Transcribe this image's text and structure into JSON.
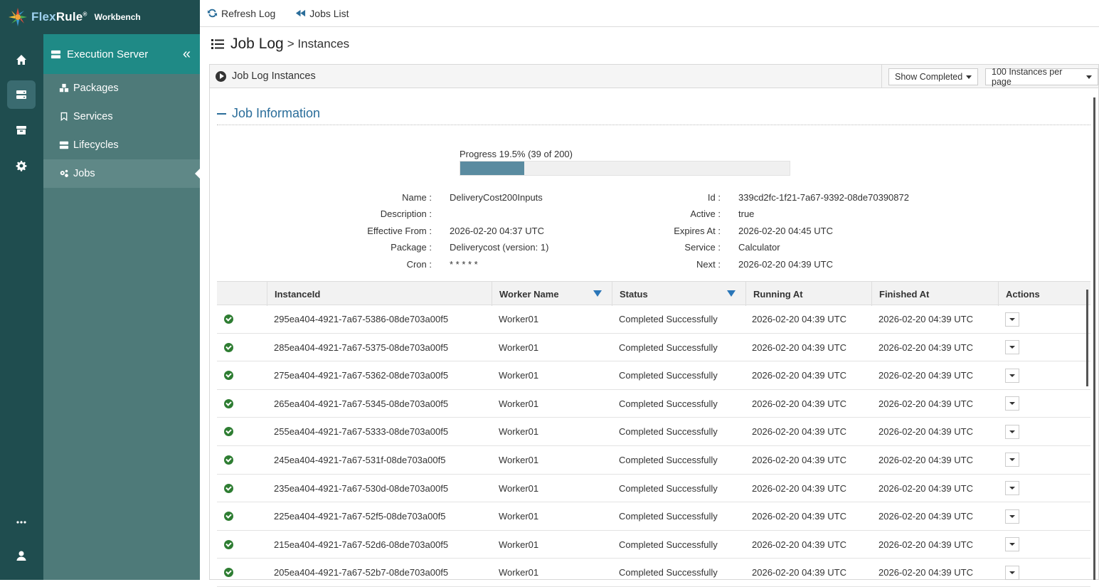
{
  "brand": {
    "name_a": "Flex",
    "name_b": "Rule",
    "reg": "®",
    "product": "Workbench"
  },
  "rail": {
    "icons": [
      "home-icon",
      "server-icon",
      "archive-icon",
      "gear-icon",
      "more-icon",
      "user-icon"
    ]
  },
  "sidebar": {
    "title": "Execution Server",
    "collapse": "«",
    "items": [
      {
        "label": "Packages",
        "icon": "cubes-icon"
      },
      {
        "label": "Services",
        "icon": "bookmark-icon"
      },
      {
        "label": "Lifecycles",
        "icon": "server-icon"
      },
      {
        "label": "Jobs",
        "icon": "gears-icon"
      }
    ]
  },
  "toolbar": {
    "refresh": "Refresh Log",
    "jobs_list": "Jobs List"
  },
  "page": {
    "title": "Job Log",
    "crumb": "> Instances"
  },
  "panel": {
    "title": "Job Log Instances",
    "filter": "Show Completed",
    "per_page": "100 Instances per page"
  },
  "section": {
    "title": "Job Information"
  },
  "progress": {
    "label": "Progress 19.5% (39 of 200)",
    "fraction": 0.195
  },
  "info": {
    "name_label": "Name :",
    "name": "DeliveryCost200Inputs",
    "desc_label": "Description :",
    "desc": "",
    "eff_label": "Effective From :",
    "eff": "2026-02-20 04:37 UTC",
    "pkg_label": "Package :",
    "pkg": "Deliverycost (version: 1)",
    "cron_label": "Cron :",
    "cron": "* * * * *",
    "id_label": "Id :",
    "id": "339cd2fc-1f21-7a67-9392-08de70390872",
    "active_label": "Active :",
    "active": "true",
    "exp_label": "Expires At :",
    "exp": "2026-02-20 04:45 UTC",
    "svc_label": "Service :",
    "svc": "Calculator",
    "next_label": "Next :",
    "next": "2026-02-20 04:39 UTC"
  },
  "table": {
    "headers": [
      "InstanceId",
      "Worker Name",
      "Status",
      "Running At",
      "Finished At",
      "Actions"
    ],
    "rows": [
      [
        "295ea404-4921-7a67-5386-08de703a00f5",
        "Worker01",
        "Completed Successfully",
        "2026-02-20 04:39 UTC",
        "2026-02-20 04:39 UTC"
      ],
      [
        "285ea404-4921-7a67-5375-08de703a00f5",
        "Worker01",
        "Completed Successfully",
        "2026-02-20 04:39 UTC",
        "2026-02-20 04:39 UTC"
      ],
      [
        "275ea404-4921-7a67-5362-08de703a00f5",
        "Worker01",
        "Completed Successfully",
        "2026-02-20 04:39 UTC",
        "2026-02-20 04:39 UTC"
      ],
      [
        "265ea404-4921-7a67-5345-08de703a00f5",
        "Worker01",
        "Completed Successfully",
        "2026-02-20 04:39 UTC",
        "2026-02-20 04:39 UTC"
      ],
      [
        "255ea404-4921-7a67-5333-08de703a00f5",
        "Worker01",
        "Completed Successfully",
        "2026-02-20 04:39 UTC",
        "2026-02-20 04:39 UTC"
      ],
      [
        "245ea404-4921-7a67-531f-08de703a00f5",
        "Worker01",
        "Completed Successfully",
        "2026-02-20 04:39 UTC",
        "2026-02-20 04:39 UTC"
      ],
      [
        "235ea404-4921-7a67-530d-08de703a00f5",
        "Worker01",
        "Completed Successfully",
        "2026-02-20 04:39 UTC",
        "2026-02-20 04:39 UTC"
      ],
      [
        "225ea404-4921-7a67-52f5-08de703a00f5",
        "Worker01",
        "Completed Successfully",
        "2026-02-20 04:39 UTC",
        "2026-02-20 04:39 UTC"
      ],
      [
        "215ea404-4921-7a67-52d6-08de703a00f5",
        "Worker01",
        "Completed Successfully",
        "2026-02-20 04:39 UTC",
        "2026-02-20 04:39 UTC"
      ],
      [
        "205ea404-4921-7a67-52b7-08de703a00f5",
        "Worker01",
        "Completed Successfully",
        "2026-02-20 04:39 UTC",
        "2026-02-20 04:39 UTC"
      ]
    ]
  },
  "colors": {
    "rail": "#1f4d4f",
    "sidebar": "#4e7a79",
    "accent": "#1f8a86",
    "link": "#2a6d9a",
    "success": "#2e7d32"
  }
}
